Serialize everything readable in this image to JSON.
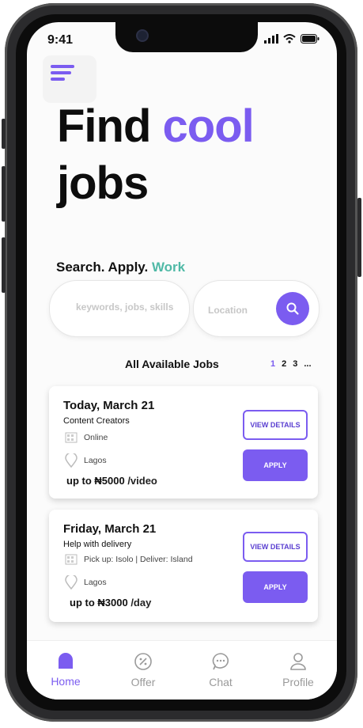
{
  "status_bar": {
    "time": "9:41"
  },
  "hero": {
    "line1": "Find",
    "accent": "cool",
    "line2": "jobs"
  },
  "tagline": {
    "text": "Search. Apply.",
    "accent": "Work"
  },
  "search": {
    "keywords_placeholder": "keywords, jobs, skills",
    "location_placeholder": "Location"
  },
  "jobs_section": {
    "title": "All Available Jobs",
    "pages": [
      "1",
      "2",
      "3",
      "..."
    ],
    "active_page": "1"
  },
  "jobs": [
    {
      "date": "Today,  March 21",
      "category": "Content Creators",
      "mode": "Online",
      "location": "Lagos",
      "pay": "up to ₦5000",
      "pay_unit": "/video",
      "view_label": "VIEW DETAILS",
      "apply_label": "APPLY"
    },
    {
      "date": "Friday,  March 21",
      "category": "Help with delivery",
      "mode": "Pick up: Isolo  | Deliver: Island",
      "location": "Lagos",
      "pay": "up to ₦3000",
      "pay_unit": "/day",
      "view_label": "VIEW DETAILS",
      "apply_label": "APPLY"
    }
  ],
  "bottom_nav": [
    {
      "label": "Home",
      "icon": "home-icon",
      "active": true
    },
    {
      "label": "Offer",
      "icon": "offer-icon",
      "active": false
    },
    {
      "label": "Chat",
      "icon": "chat-icon",
      "active": false
    },
    {
      "label": "Profile",
      "icon": "profile-icon",
      "active": false
    }
  ],
  "colors": {
    "accent": "#7b5cf0",
    "teal": "#4fb9a6",
    "text": "#111111",
    "muted": "#9a9a9a"
  }
}
